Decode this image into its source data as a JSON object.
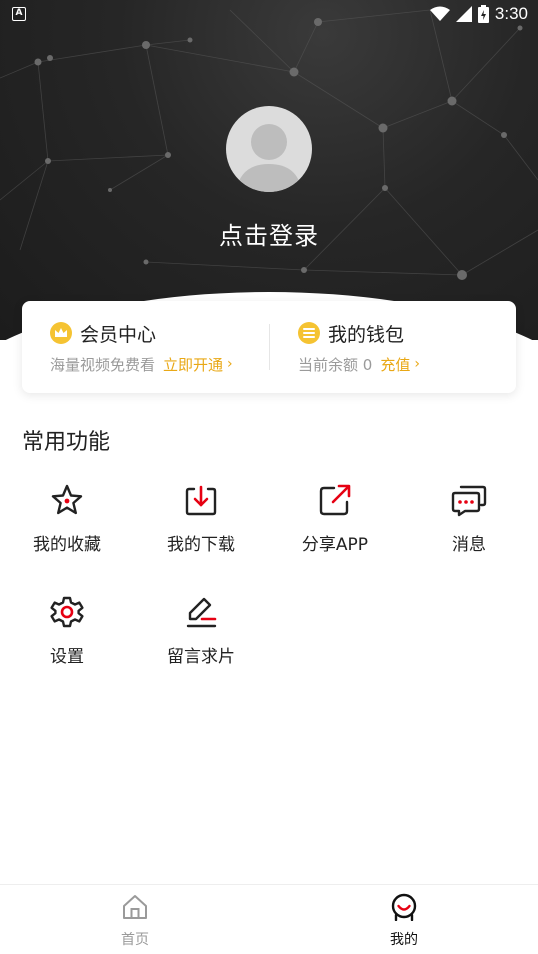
{
  "status_bar": {
    "time": "3:30",
    "left_icon_text": "A"
  },
  "profile": {
    "login_text": "点击登录"
  },
  "cards": {
    "member": {
      "title": "会员中心",
      "subtitle": "海量视频免费看",
      "link": "立即开通"
    },
    "wallet": {
      "title": "我的钱包",
      "subtitle": "当前余额 0",
      "link": "充值"
    }
  },
  "section": {
    "title": "常用功能"
  },
  "functions": [
    {
      "label": "我的收藏",
      "icon": "star-icon"
    },
    {
      "label": "我的下载",
      "icon": "download-icon"
    },
    {
      "label": "分享APP",
      "icon": "share-icon"
    },
    {
      "label": "消息",
      "icon": "message-icon"
    },
    {
      "label": "设置",
      "icon": "gear-icon"
    },
    {
      "label": "留言求片",
      "icon": "edit-icon"
    }
  ],
  "bottom_nav": [
    {
      "label": "首页",
      "icon": "home-icon",
      "active": false
    },
    {
      "label": "我的",
      "icon": "profile-icon",
      "active": true
    }
  ],
  "colors": {
    "accent": "#e60012",
    "gold": "#e9a816",
    "header_bg": "#222222",
    "inactive": "#9a9a9a"
  }
}
